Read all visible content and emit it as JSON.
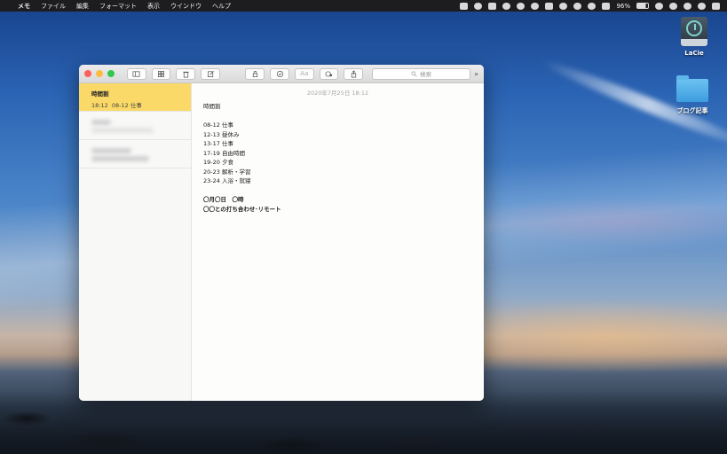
{
  "menubar": {
    "app_name": "メモ",
    "menus": [
      "ファイル",
      "編集",
      "フォーマット",
      "表示",
      "ウインドウ",
      "ヘルプ"
    ],
    "battery": "96%"
  },
  "desktop": {
    "icons": [
      {
        "label": "LaCie",
        "icon": "time-machine-drive-icon"
      },
      {
        "label": "ブログ記事",
        "icon": "folder-icon"
      }
    ]
  },
  "toolbar": {
    "search_placeholder": "検索",
    "font_label": "Aa"
  },
  "sidebar": {
    "notes": [
      {
        "title": "時間割",
        "time": "18:12",
        "preview": "08-12 仕事",
        "selected": true
      },
      {
        "blurred": true
      },
      {
        "blurred": true
      }
    ]
  },
  "editor": {
    "date": "2020年7月25日 18:12",
    "lines": [
      {
        "text": "時間割",
        "bold": false
      },
      {
        "text": "",
        "bold": false
      },
      {
        "text": "08-12 仕事",
        "bold": false
      },
      {
        "text": "12-13 昼休み",
        "bold": false
      },
      {
        "text": "13-17 仕事",
        "bold": false
      },
      {
        "text": "17-19 自由時間",
        "bold": false
      },
      {
        "text": "19-20 夕食",
        "bold": false
      },
      {
        "text": "20-23 解析・学習",
        "bold": false
      },
      {
        "text": "23-24 入浴・就寝",
        "bold": false
      },
      {
        "text": "",
        "bold": false
      },
      {
        "text": "〇月〇日　〇時",
        "bold": true
      },
      {
        "text": "〇〇との打ち合わせ･リモート",
        "bold": true
      }
    ]
  }
}
